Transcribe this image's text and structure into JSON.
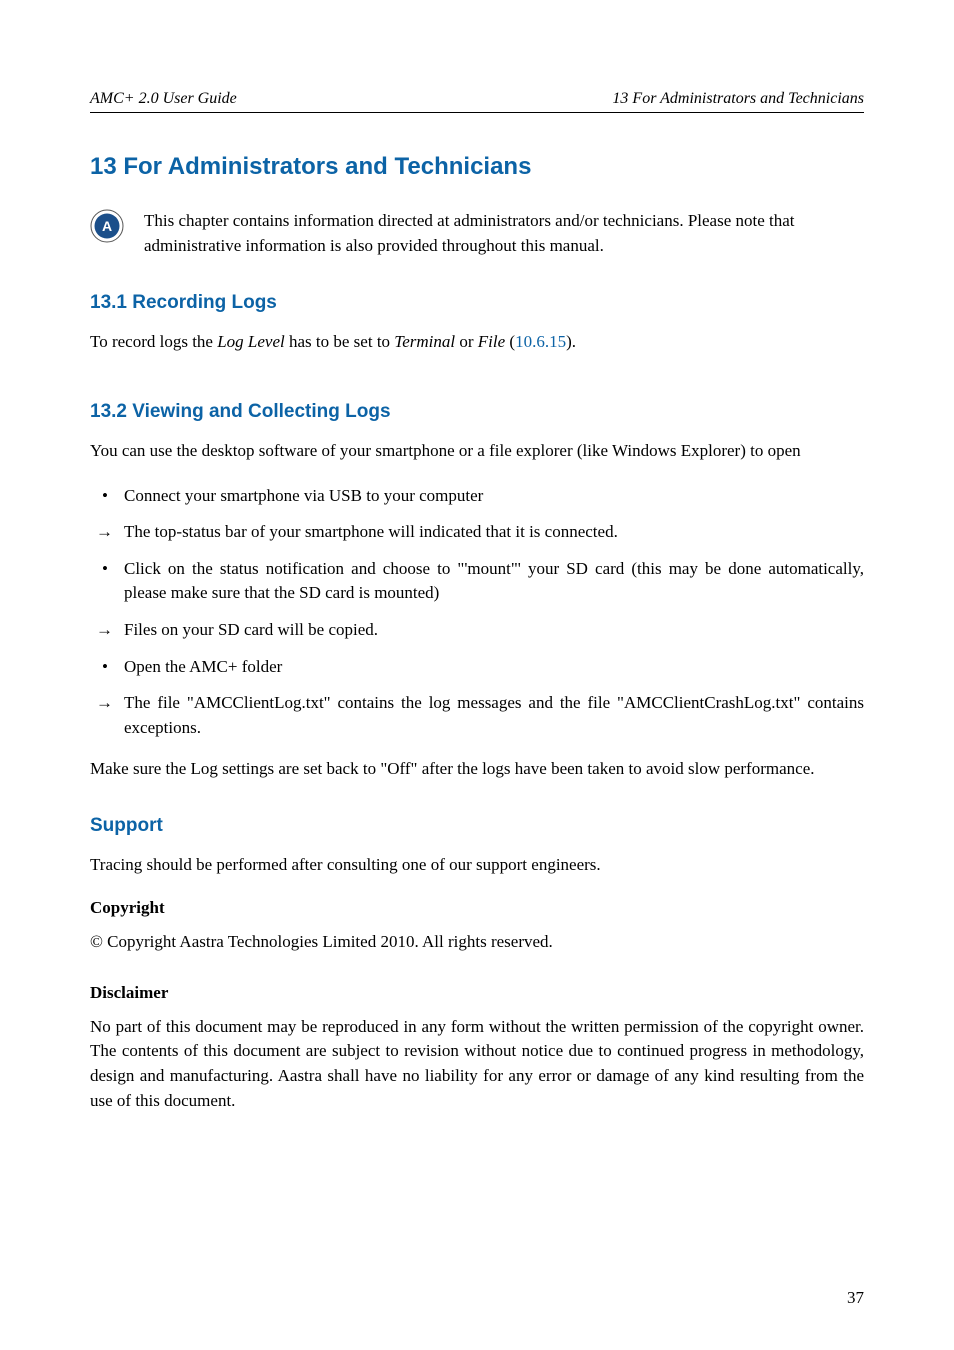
{
  "header": {
    "left": "AMC+ 2.0 User Guide",
    "right": "13  For Administrators and Technicians"
  },
  "title": "13  For Administrators and Technicians",
  "badge_letter": "A",
  "intro": "This chapter contains information directed at administrators and/or technicians. Please note that administrative information is also provided throughout this manual.",
  "sec131": {
    "heading": "13.1 Recording Logs",
    "p1_pre": "To record logs the ",
    "p1_i1": "Log Level",
    "p1_mid1": " has to be set to ",
    "p1_i2": "Terminal",
    "p1_mid2": " or ",
    "p1_i3": "File",
    "p1_mid3": " (",
    "p1_link": "10.6.15",
    "p1_end": ")."
  },
  "sec132": {
    "heading": "13.2 Viewing and Collecting Logs",
    "intro": "You can use the desktop software of your smartphone or a file explorer (like Windows Explorer) to open",
    "items": [
      {
        "marker": "•",
        "text": "Connect your smartphone via USB to your computer"
      },
      {
        "marker": "→",
        "text": "The top-status bar of your smartphone will indicated that it is connected."
      },
      {
        "marker": "•",
        "text": "Click on the status notification and choose to \"'mount\"' your SD card (this may be done automatically, please make sure that the SD card is mounted)"
      },
      {
        "marker": "→",
        "text": "Files on your SD card will be copied."
      },
      {
        "marker": "•",
        "text": "Open the AMC+ folder"
      },
      {
        "marker": "→",
        "text": "The file \"AMCClientLog.txt\" contains the log messages and the file \"AMCClientCrashLog.txt\" contains exceptions."
      }
    ],
    "outro": "Make sure the Log settings are set back to \"Off\" after the logs have been taken to avoid slow performance."
  },
  "support": {
    "heading": "Support",
    "text": "Tracing should be performed after consulting one of our support engineers."
  },
  "copyright": {
    "heading": "Copyright",
    "text": "© Copyright Aastra Technologies Limited 2010. All rights reserved."
  },
  "disclaimer": {
    "heading": "Disclaimer",
    "text": "No part of this document may be reproduced in any form without the written permission of the copyright owner. The contents of this document are subject to revision without notice due to continued progress in methodology, design and manufacturing. Aastra shall have no liability for any error or damage of any kind resulting from the use of this document."
  },
  "page_number": "37"
}
